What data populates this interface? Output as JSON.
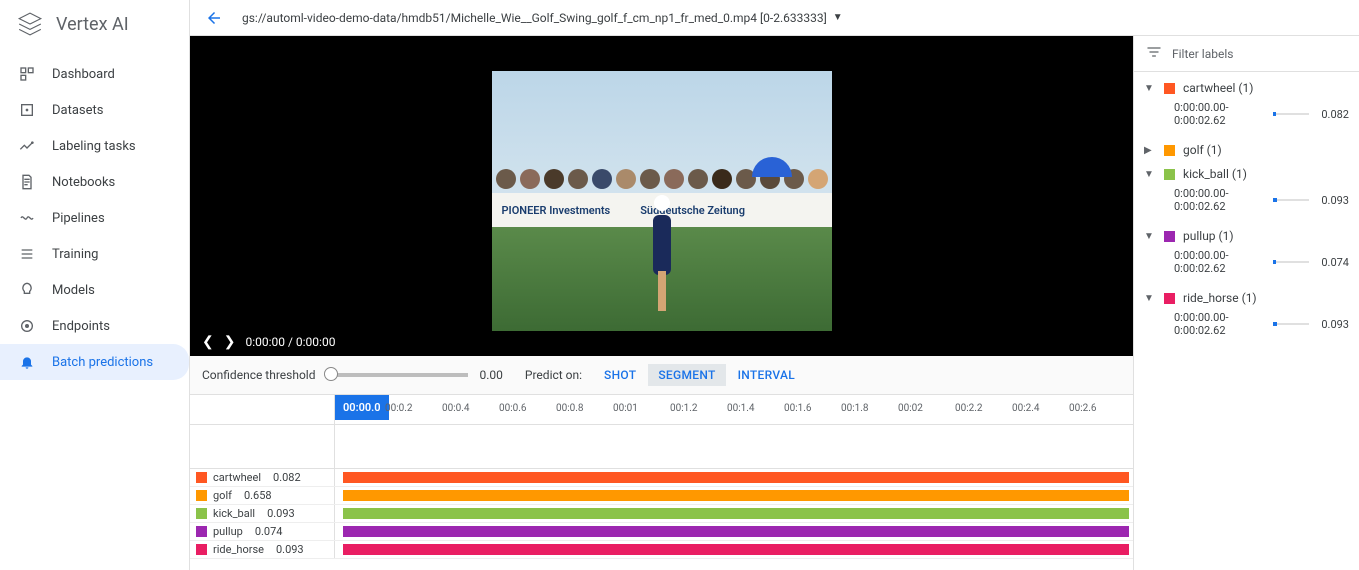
{
  "brand": "Vertex AI",
  "nav": [
    {
      "label": "Dashboard"
    },
    {
      "label": "Datasets"
    },
    {
      "label": "Labeling tasks"
    },
    {
      "label": "Notebooks"
    },
    {
      "label": "Pipelines"
    },
    {
      "label": "Training"
    },
    {
      "label": "Models"
    },
    {
      "label": "Endpoints"
    },
    {
      "label": "Batch predictions"
    }
  ],
  "path": "gs://automl-video-demo-data/hmdb51/Michelle_Wie__Golf_Swing_golf_f_cm_np1_fr_med_0.mp4 [0-2.633333]",
  "playback": {
    "time": "0:00:00 / 0:00:00"
  },
  "confidence": {
    "label": "Confidence threshold",
    "value": "0.00"
  },
  "predict": {
    "label": "Predict on:",
    "shot": "SHOT",
    "segment": "SEGMENT",
    "interval": "INTERVAL"
  },
  "banner": {
    "left": "PIONEER Investments",
    "right": "Süddeutsche Zeitung"
  },
  "ruler": {
    "marker": "00:00.0",
    "ticks": [
      "00:0.2",
      "00:0.4",
      "00:0.6",
      "00:0.8",
      "00:01",
      "00:1.2",
      "00:1.4",
      "00:1.6",
      "00:1.8",
      "00:02",
      "00:2.2",
      "00:2.4",
      "00:2.6"
    ]
  },
  "tracks": [
    {
      "name": "cartwheel",
      "score": "0.082",
      "colorClass": "c-cartwheel"
    },
    {
      "name": "golf",
      "score": "0.658",
      "colorClass": "c-golf"
    },
    {
      "name": "kick_ball",
      "score": "0.093",
      "colorClass": "c-kickball"
    },
    {
      "name": "pullup",
      "score": "0.074",
      "colorClass": "c-pullup"
    },
    {
      "name": "ride_horse",
      "score": "0.093",
      "colorClass": "c-ridehorse"
    }
  ],
  "right": {
    "filter": "Filter labels",
    "items": [
      {
        "title": "cartwheel (1)",
        "colorClass": "c-cartwheel",
        "expanded": true,
        "seg": "0:00:00.00-0:00:02.62",
        "score": "0.082",
        "w": "8"
      },
      {
        "title": "golf (1)",
        "colorClass": "c-golf",
        "expanded": false
      },
      {
        "title": "kick_ball (1)",
        "colorClass": "c-kickball",
        "expanded": true,
        "seg": "0:00:00.00-0:00:02.62",
        "score": "0.093",
        "w": "9"
      },
      {
        "title": "pullup (1)",
        "colorClass": "c-pullup",
        "expanded": true,
        "seg": "0:00:00.00-0:00:02.62",
        "score": "0.074",
        "w": "7"
      },
      {
        "title": "ride_horse (1)",
        "colorClass": "c-ridehorse",
        "expanded": true,
        "seg": "0:00:00.00-0:00:02.62",
        "score": "0.093",
        "w": "9"
      }
    ]
  }
}
